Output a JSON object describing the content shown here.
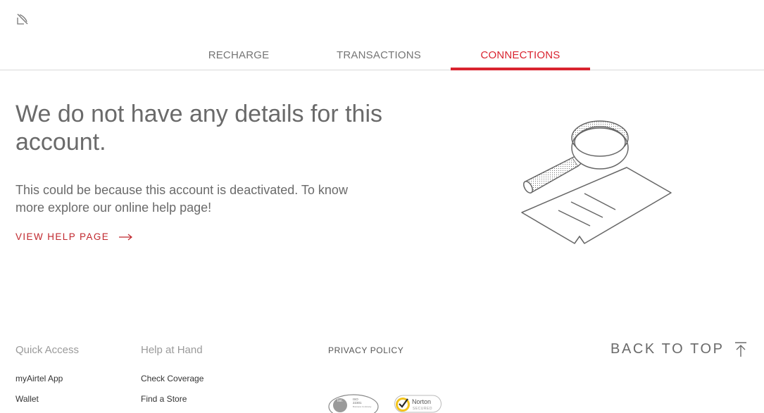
{
  "tabs": [
    {
      "label": "RECHARGE",
      "active": false
    },
    {
      "label": "TRANSACTIONS",
      "active": false
    },
    {
      "label": "CONNECTIONS",
      "active": true
    }
  ],
  "main": {
    "headline": "We do not have any details for this account.",
    "subtext": "This could be because this account is deactivated. To know more explore our online help page!",
    "help_link": "VIEW HELP PAGE"
  },
  "footer": {
    "quick_access": {
      "title": "Quick Access",
      "links": [
        "myAirtel App",
        "Wallet"
      ]
    },
    "help_at_hand": {
      "title": "Help at Hand",
      "links": [
        "Check Coverage",
        "Find a Store"
      ]
    },
    "privacy_policy": "PRIVACY POLICY",
    "back_to_top": "BACK TO TOP",
    "badges": {
      "bsi": {
        "line1": "bsi.",
        "line2": "ISO",
        "line3": "22301",
        "line4": "Business Continuity"
      },
      "norton": {
        "line1": "Norton",
        "line2": "SECURED"
      }
    }
  },
  "colors": {
    "accent": "#d9232f",
    "text": "#6a6a6a",
    "divider": "#d9d9d9"
  },
  "icons": {
    "logo": "satellite-icon",
    "arrow": "arrow-right-icon",
    "back_top": "arrow-up-to-line-icon",
    "illustration": "magnifier-document-illustration"
  }
}
